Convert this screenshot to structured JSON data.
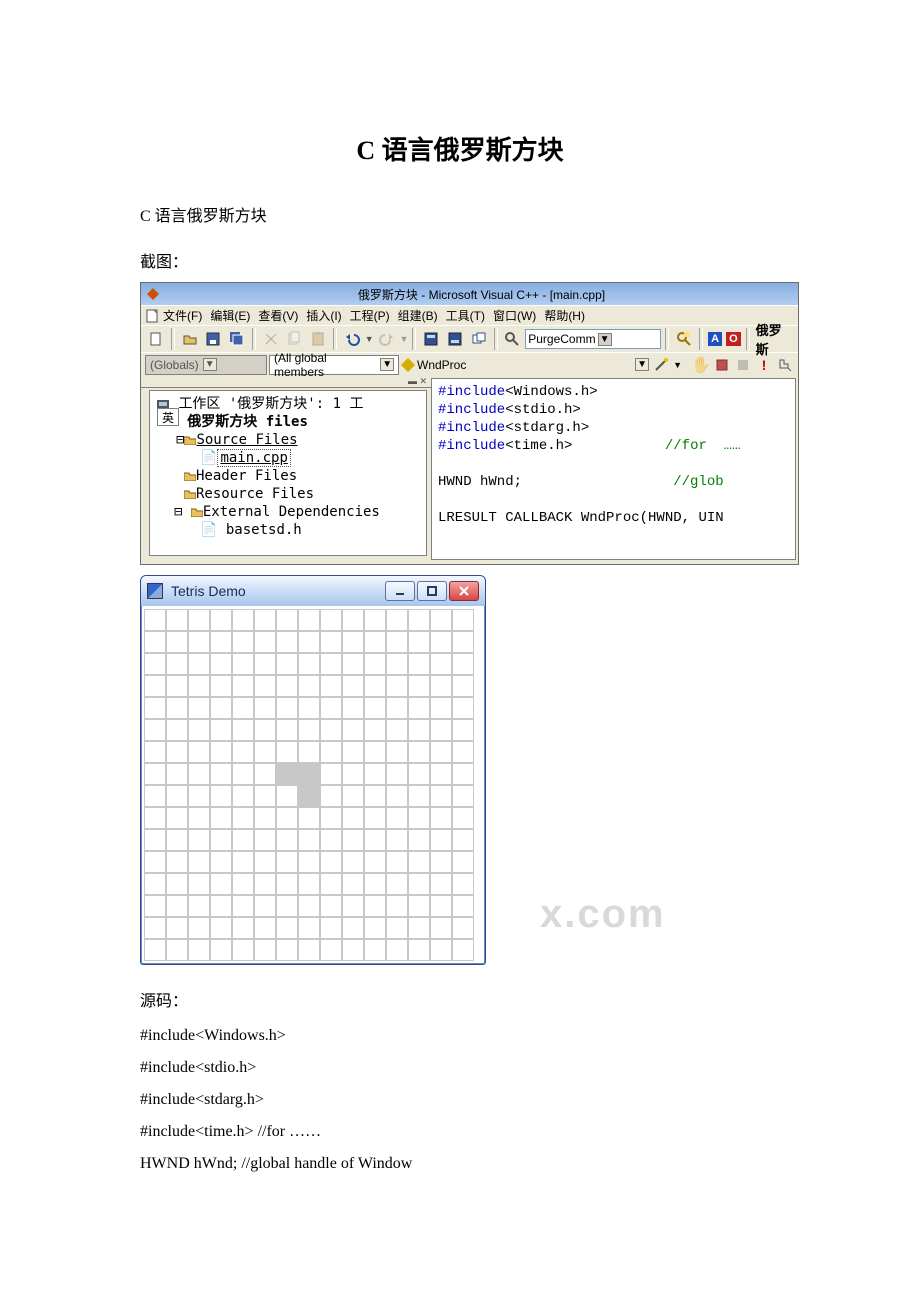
{
  "doc": {
    "title": "C 语言俄罗斯方块",
    "subtitle": "C 语言俄罗斯方块",
    "caption": "截图：",
    "source_label": "源码：",
    "code_lines": [
      "#include<Windows.h>",
      "#include<stdio.h>",
      "#include<stdarg.h>",
      "#include<time.h> //for ……",
      "HWND hWnd; //global handle of Window"
    ],
    "watermark": "x.com"
  },
  "ide": {
    "title": "俄罗斯方块 - Microsoft Visual C++ - [main.cpp]",
    "menu": [
      "文件(F)",
      "编辑(E)",
      "查看(V)",
      "插入(I)",
      "工程(P)",
      "组建(B)",
      "工具(T)",
      "窗口(W)",
      "帮助(H)"
    ],
    "find_box": "PurgeComm",
    "project_tail": "俄罗斯",
    "scope_combo": "(Globals)",
    "members_combo": "(All global members",
    "func_combo": "WndProc",
    "tree": {
      "root": "工作区 '俄罗斯方块': 1 工",
      "project": "俄罗斯方块 files",
      "source": "Source Files",
      "main": "main.cpp",
      "header": "Header Files",
      "resource": "Resource Files",
      "ext": "External Dependencies",
      "basetsd": "basetsd.h",
      "ime": "英"
    },
    "code": {
      "l1a": "#include",
      "l1b": "<Windows.h>",
      "l2a": "#include",
      "l2b": "<stdio.h>",
      "l3a": "#include",
      "l3b": "<stdarg.h>",
      "l4a": "#include",
      "l4b": "<time.h>",
      "l4c": "//for  ……",
      "l5a": "HWND hWnd;",
      "l5b": "//glob",
      "l6": "LRESULT CALLBACK WndProc(HWND, UIN"
    }
  },
  "tetris": {
    "title": "Tetris Demo",
    "cols": 15,
    "rows": 16,
    "filled": [
      [
        7,
        6
      ],
      [
        7,
        7
      ],
      [
        8,
        7
      ]
    ]
  }
}
